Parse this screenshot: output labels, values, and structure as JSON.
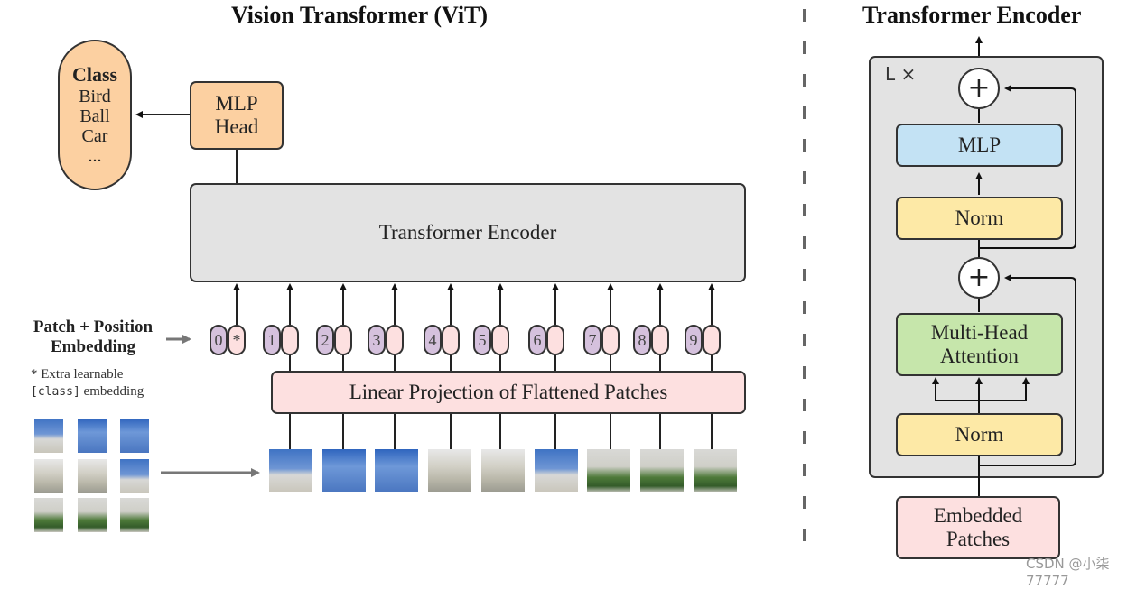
{
  "vit": {
    "title": "Vision Transformer (ViT)",
    "class_box": {
      "heading": "Class",
      "items": [
        "Bird",
        "Ball",
        "Car",
        "..."
      ]
    },
    "mlp_head": {
      "line1": "MLP",
      "line2": "Head"
    },
    "encoder_label": "Transformer Encoder",
    "embedding_label": {
      "line1": "Patch + Position",
      "line2": "Embedding"
    },
    "extra_note": {
      "line1": "* Extra learnable",
      "code": "[class]",
      "line2_rest": " embedding"
    },
    "position_ids": [
      "0",
      "1",
      "2",
      "3",
      "4",
      "5",
      "6",
      "7",
      "8",
      "9"
    ],
    "class_token_symbol": "*",
    "projection_label": "Linear Projection of Flattened Patches",
    "patch_count": 9
  },
  "encoder_detail": {
    "title": "Transformer Encoder",
    "repeat_label": "L ×",
    "add_symbol": "+",
    "mlp": "MLP",
    "norm_top": "Norm",
    "attention": {
      "line1": "Multi-Head",
      "line2": "Attention"
    },
    "norm_bottom": "Norm",
    "input": {
      "line1": "Embedded",
      "line2": "Patches"
    }
  },
  "watermark": "CSDN @小柒77777"
}
